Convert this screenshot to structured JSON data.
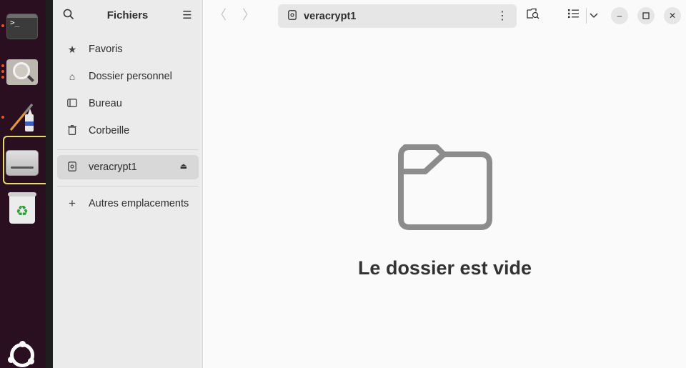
{
  "dock": {
    "items": [
      {
        "name": "terminal",
        "glyph": ">_"
      },
      {
        "name": "search"
      },
      {
        "name": "paint-editor"
      },
      {
        "name": "disk-drive"
      },
      {
        "name": "trash",
        "glyph": "♻"
      }
    ]
  },
  "sidebar": {
    "title": "Fichiers",
    "places": [
      {
        "label": "Favoris",
        "icon": "star-icon"
      },
      {
        "label": "Dossier personnel",
        "icon": "home-icon"
      },
      {
        "label": "Bureau",
        "icon": "desktop-icon"
      },
      {
        "label": "Corbeille",
        "icon": "trash-icon"
      }
    ],
    "mounts": [
      {
        "label": "veracrypt1",
        "icon": "drive-icon",
        "active": true
      }
    ],
    "other": {
      "label": "Autres emplacements",
      "icon": "plus-icon"
    }
  },
  "toolbar": {
    "path_label": "veracrypt1"
  },
  "main": {
    "empty_text": "Le dossier est vide"
  },
  "colors": {
    "dock_bg": "#2a0f21",
    "accent": "#e95420",
    "sidebar_bg": "#ebebeb",
    "active_item": "#d8d8d8"
  }
}
